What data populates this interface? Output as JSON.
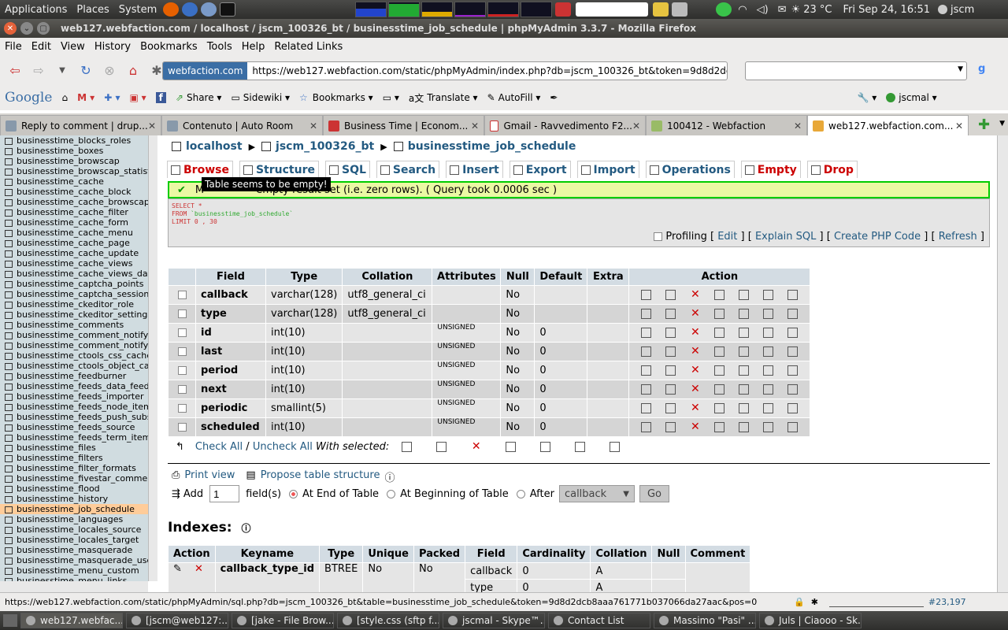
{
  "gnome_panel": {
    "menus": [
      "Applications",
      "Places",
      "System"
    ],
    "temperature": "23 °C",
    "clock": "Fri Sep 24, 16:51",
    "user": "jscm"
  },
  "window": {
    "title": "web127.webfaction.com / localhost / jscm_100326_bt / businesstime_job_schedule | phpMyAdmin 3.3.7 - Mozilla Firefox"
  },
  "menubar": [
    "File",
    "Edit",
    "View",
    "History",
    "Bookmarks",
    "Tools",
    "Help",
    "Related Links"
  ],
  "navbar": {
    "identity": "webfaction.com",
    "url": "https://web127.webfaction.com/static/phpMyAdmin/index.php?db=jscm_100326_bt&token=9d8d2dct"
  },
  "bookmarks": {
    "google": "Google",
    "share": "Share",
    "sidewiki": "Sidewiki",
    "bookmarks": "Bookmarks",
    "translate": "Translate",
    "autofill": "AutoFill",
    "account": "jscmal"
  },
  "tabs": [
    "Reply to comment | drup...",
    "Contenuto | Auto Room",
    "Business Time | Econom...",
    "Gmail - Ravvedimento F2...",
    "100412 - Webfaction",
    "web127.webfaction.com..."
  ],
  "leftnav": {
    "tables": [
      "businesstime_blocks_roles",
      "businesstime_boxes",
      "businesstime_browscap",
      "businesstime_browscap_statisti",
      "businesstime_cache",
      "businesstime_cache_block",
      "businesstime_cache_browscap",
      "businesstime_cache_filter",
      "businesstime_cache_form",
      "businesstime_cache_menu",
      "businesstime_cache_page",
      "businesstime_cache_update",
      "businesstime_cache_views",
      "businesstime_cache_views_data",
      "businesstime_captcha_points",
      "businesstime_captcha_sessions",
      "businesstime_ckeditor_role",
      "businesstime_ckeditor_settings",
      "businesstime_comments",
      "businesstime_comment_notify",
      "businesstime_comment_notify_",
      "businesstime_ctools_css_cache",
      "businesstime_ctools_object_cac",
      "businesstime_feedburner",
      "businesstime_feeds_data_feed_",
      "businesstime_feeds_importer",
      "businesstime_feeds_node_item",
      "businesstime_feeds_push_subs",
      "businesstime_feeds_source",
      "businesstime_feeds_term_item",
      "businesstime_files",
      "businesstime_filters",
      "businesstime_filter_formats",
      "businesstime_fivestar_comment",
      "businesstime_flood",
      "businesstime_history",
      "businesstime_job_schedule",
      "businesstime_languages",
      "businesstime_locales_source",
      "businesstime_locales_target",
      "businesstime_masquerade",
      "businesstime_masquerade_user",
      "businesstime_menu_custom",
      "businesstime_menu_links"
    ],
    "selected_index": 36
  },
  "breadcrumb": {
    "server": "localhost",
    "database": "jscm_100326_bt",
    "table": "businesstime_job_schedule"
  },
  "topmenu": [
    "Browse",
    "Structure",
    "SQL",
    "Search",
    "Insert",
    "Export",
    "Import",
    "Operations",
    "Empty",
    "Drop"
  ],
  "tooltip": "Table seems to be empty!",
  "message": {
    "text": "MySQL returned an empty result set (i.e. zero rows). ( Query took 0.0006 sec )",
    "visible_text": "M                empty result set (i.e. zero rows). ( Query took 0.0006 sec )"
  },
  "sql": {
    "line1": "SELECT *",
    "line2_kw": "FROM",
    "line2_tbl": "`businesstime_job_schedule`",
    "line3": "LIMIT 0 , 30"
  },
  "profiling": {
    "label": "Profiling",
    "edit": "Edit",
    "explain": "Explain SQL",
    "php": "Create PHP Code",
    "refresh": "Refresh"
  },
  "structure": {
    "headers": [
      "Field",
      "Type",
      "Collation",
      "Attributes",
      "Null",
      "Default",
      "Extra",
      "Action"
    ],
    "rows": [
      {
        "field": "callback",
        "type": "varchar(128)",
        "collation": "utf8_general_ci",
        "attributes": "",
        "null": "No",
        "default": "",
        "extra": ""
      },
      {
        "field": "type",
        "type": "varchar(128)",
        "collation": "utf8_general_ci",
        "attributes": "",
        "null": "No",
        "default": "",
        "extra": ""
      },
      {
        "field": "id",
        "type": "int(10)",
        "collation": "",
        "attributes": "UNSIGNED",
        "null": "No",
        "default": "0",
        "extra": ""
      },
      {
        "field": "last",
        "type": "int(10)",
        "collation": "",
        "attributes": "UNSIGNED",
        "null": "No",
        "default": "0",
        "extra": ""
      },
      {
        "field": "period",
        "type": "int(10)",
        "collation": "",
        "attributes": "UNSIGNED",
        "null": "No",
        "default": "0",
        "extra": ""
      },
      {
        "field": "next",
        "type": "int(10)",
        "collation": "",
        "attributes": "UNSIGNED",
        "null": "No",
        "default": "0",
        "extra": ""
      },
      {
        "field": "periodic",
        "type": "smallint(5)",
        "collation": "",
        "attributes": "UNSIGNED",
        "null": "No",
        "default": "0",
        "extra": ""
      },
      {
        "field": "scheduled",
        "type": "int(10)",
        "collation": "",
        "attributes": "UNSIGNED",
        "null": "No",
        "default": "0",
        "extra": ""
      }
    ]
  },
  "with_selected": {
    "check_all": "Check All",
    "uncheck_all": "Uncheck All",
    "label": "With selected:"
  },
  "table_ops": {
    "print_view": "Print view",
    "propose": "Propose table structure",
    "add": "Add",
    "add_count": "1",
    "fields": "field(s)",
    "at_end": "At End of Table",
    "at_beginning": "At Beginning of Table",
    "after": "After",
    "after_field": "callback",
    "go": "Go"
  },
  "indexes": {
    "title": "Indexes:",
    "headers": [
      "Action",
      "Keyname",
      "Type",
      "Unique",
      "Packed",
      "Field",
      "Cardinality",
      "Collation",
      "Null",
      "Comment"
    ],
    "keyname": "callback_type_id",
    "type": "BTREE",
    "unique": "No",
    "packed": "No",
    "fields": [
      {
        "field": "callback",
        "cardinality": "0",
        "collation": "A"
      },
      {
        "field": "type",
        "cardinality": "0",
        "collation": "A"
      }
    ]
  },
  "statusbar": {
    "url": "https://web127.webfaction.com/static/phpMyAdmin/sql.php?db=jscm_100326_bt&table=businesstime_job_schedule&token=9d8d2dcb8aaa761771b037066da27aac&pos=0",
    "counter": "#23,197"
  },
  "taskbar": [
    "web127.webfac...",
    "[jscm@web127:...",
    "[jake - File Brow...",
    "[style.css (sftp f...",
    "jscmal - Skype™...",
    "Contact List",
    "Massimo \"Pasi\" ...",
    "Juls | Ciaooo - Sk..."
  ]
}
